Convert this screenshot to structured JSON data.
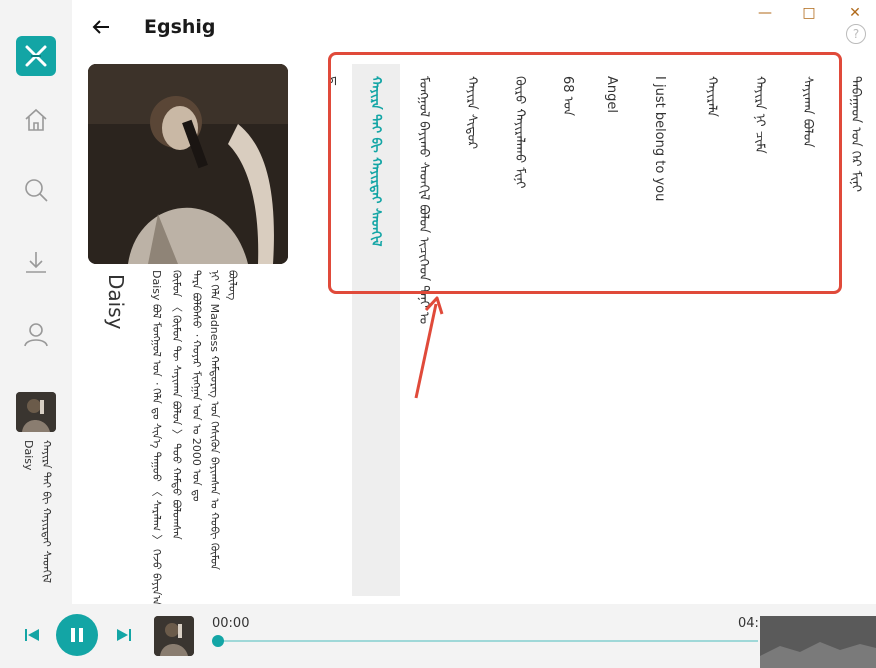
{
  "header": {
    "title": "Egshig",
    "help_glyph": "?"
  },
  "window_controls": {
    "minimize": "—",
    "maximize": "□",
    "close": "✕"
  },
  "artist": {
    "name": "Daisy",
    "bio_lines": [
      "ᠪᠦᠯᠦᠭ",
      "ᠨᠢ ᠬᠡᠯᠡ Madness ᠬᠠᠮᠲᠦᠷᠡᠭ ᠤᠨ ᠭᠡᠰᠢᠭᠦᠨ ᠪᠠᠶᠢᠭᠰᠠᠨ ᠤ ᠬᠤᠪᠢ ᠬᠦᠮᠦᠨ",
      "ᠲᠡᠷᠡ ᠪᠣᠯᠪᠠᠰᠤ ᠂ ᠬᠣᠶᠠᠷ ᠮᠢᠩᠭᠠᠨ ᠣᠨ ᠤ 2000 ᠣᠨ ᠳᠤ",
      "ᠬᠦᠮᠦᠨ 〈 ᠬᠦᠮᠦᠨ ᠲᠦ ᠰᠠᠶᠢᠬᠠᠨ ᠪᠣᠯᠤᠨ 〉 ᠳᠤᠤ ᠬᠠᠮᠲᠤ ᠪᠣᠯᠤᠭᠰᠠᠨ",
      "Daisy ᠪᠣᠯ ᠮᠣᠩᠭᠣᠯ ᠤᠨ ᠂ ᠬᠡᠯᠡ ᠳᠤ ᠰᠢᠨ᠎ᠡ ᠳᠠᠭᠤᠤ 〈 ᠰᠠᠷᠠᠯᠠᠭ 〉 ᠭᠡᠵᠦ ᠪᠠᠶᠢᠨ᠎ᠠ"
    ]
  },
  "tracks": [
    {
      "label": "ᠬᠠᠶᠢᠷᠠ ᠲᠠᠢ ᠪᠢ ᠬᠠᠶᠢᠷᠲᠠᠢ ᠰᠡᠳᠬᠢᠯ",
      "active": true
    },
    {
      "label": "ᠮᠣᠩᠭᠣᠯ ᠪᠠᠶᠢᠬᠤ ᠰᠡᠳᠬᠢᠯ ᠪᠣᠯᠤᠨ ᠢᠴᠢᠭᠡᠳ ᠲᠠᠨᠢ ᠤ",
      "active": false
    },
    {
      "label": "ᠬᠠᠶᠢᠷᠠ ᠰᠢᠳᠦᠷ",
      "active": false
    },
    {
      "label": "ᠬᠦᠷᠦ ᠬᠠᠶᠢᠷᠠᠯᠠᠬᠤ ᠮᠢᠨᠢ",
      "active": false
    },
    {
      "label": "68 ᠣᠨ",
      "active": false
    },
    {
      "label": "Angel",
      "active": false
    },
    {
      "label": "I just belong to you",
      "active": false
    },
    {
      "label": "ᠬᠠᠶᠢᠷᠠᠯᠠ",
      "active": false
    },
    {
      "label": "ᠬᠠᠶᠢᠷᠠ ᠨᠢ ᠴᠢᠮᠠ",
      "active": false
    },
    {
      "label": "ᠰᠠᠶᠢᠬᠠᠨ ᠪᠣᠯᠣᠨ",
      "active": false
    },
    {
      "label": "ᠲᠠᠪᠠᠭᠠᠳ ᠤᠨ ᠭᠡᠷ ᠮᠢᠨᠢ",
      "active": false
    }
  ],
  "track_more_glyph": "⋮",
  "partial_track_glyph": "ᠳ",
  "rail": {
    "now_playing_artist": "Daisy",
    "now_playing_title": "ᠬᠠᠶᠢᠷᠠ ᠲᠠᠢ ᠪᠢ ᠬᠠᠶᠢᠷᠲᠠᠢ ᠰᠡᠳᠬᠢᠯ"
  },
  "player": {
    "time_current": "00:00",
    "time_end": "04:",
    "progress": 0.0
  },
  "colors": {
    "accent": "#13a5a5",
    "highlight": "#e04a3a"
  }
}
